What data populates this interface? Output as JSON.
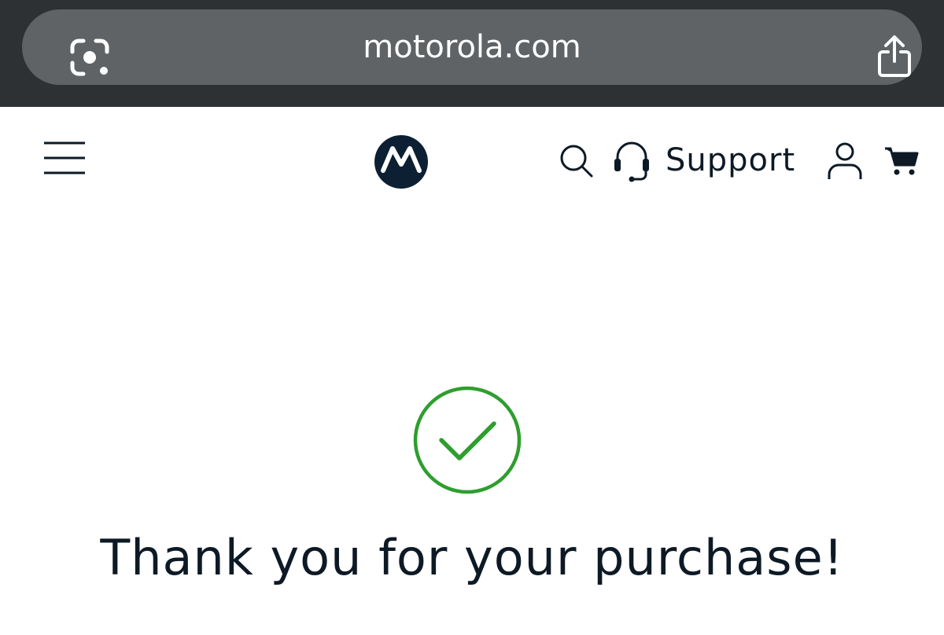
{
  "browser": {
    "url": "motorola.com",
    "left_icon": "lens-icon",
    "right_icon": "share-icon"
  },
  "header": {
    "menu_icon": "hamburger-menu-icon",
    "logo_icon": "motorola-logo",
    "search_icon": "search-icon",
    "support_icon": "headset-icon",
    "support_label": "Support",
    "account_icon": "account-icon",
    "cart_icon": "cart-icon"
  },
  "main": {
    "status_icon": "checkmark-circle-icon",
    "heading": "Thank you for your purchase!"
  },
  "colors": {
    "browser_bg": "#2e3133",
    "url_pill": "#5f6366",
    "text_dark": "#0d1a26",
    "logo_bg": "#0d1f33",
    "success_green": "#2e9e2e"
  }
}
